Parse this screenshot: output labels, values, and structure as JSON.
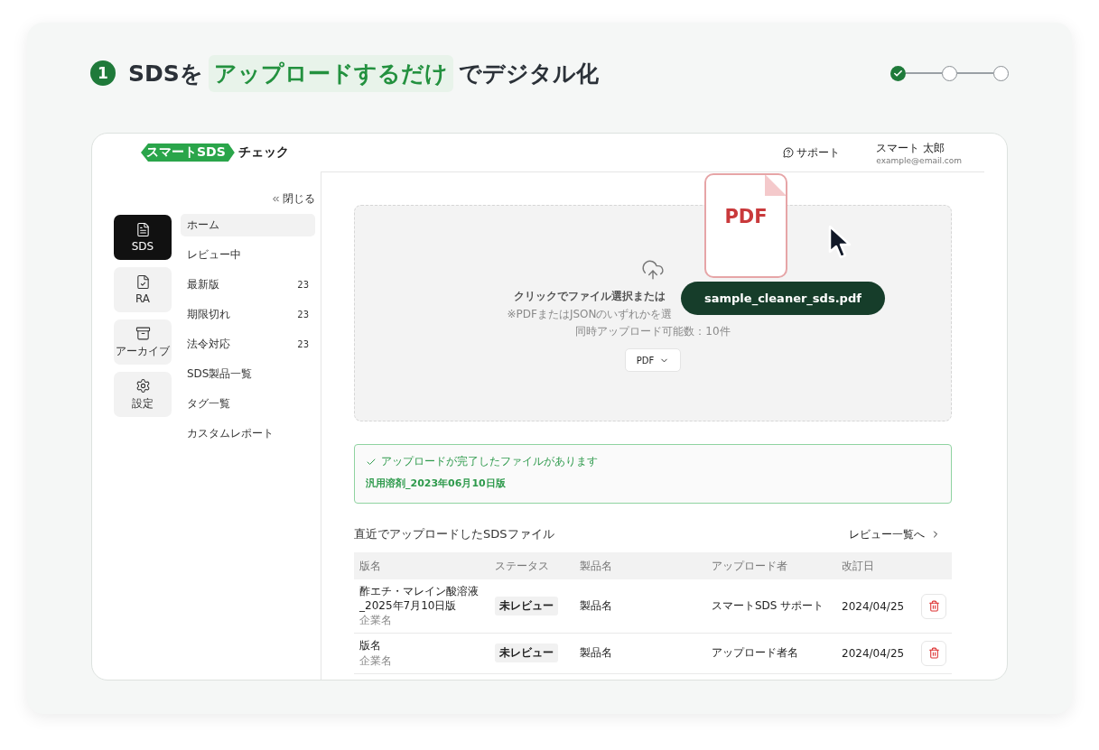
{
  "heading": {
    "number": "1",
    "parts": [
      {
        "text": "SDSを",
        "kind": "plain"
      },
      {
        "text": "アップロードするだけ",
        "kind": "highlight"
      },
      {
        "text": "でデジタル化",
        "kind": "plain"
      }
    ]
  },
  "steps": [
    {
      "done": true
    },
    {
      "done": false
    },
    {
      "done": false
    }
  ],
  "app": {
    "logo": {
      "badge": "スマートSDS",
      "word": "チェック"
    },
    "header": {
      "support": "サポート",
      "user_name": "スマート 太郎",
      "user_email": "example@email.com"
    },
    "rail": [
      {
        "label": "SDS",
        "selected": true
      },
      {
        "label": "RA",
        "selected": false
      },
      {
        "label": "アーカイブ",
        "selected": false
      },
      {
        "label": "設定",
        "selected": false
      }
    ],
    "collapse": "閉じる",
    "nav": [
      {
        "label": "ホーム",
        "selected": true
      },
      {
        "label": "レビュー中",
        "selected": false
      },
      {
        "label": "最新版",
        "count": "23",
        "selected": false
      },
      {
        "label": "期限切れ",
        "count": "23",
        "selected": false
      },
      {
        "label": "法令対応",
        "count": "23",
        "selected": false
      },
      {
        "label": "SDS製品一覧",
        "selected": false
      },
      {
        "label": "タグ一覧",
        "selected": false
      },
      {
        "label": "カスタムレポート",
        "selected": false
      }
    ],
    "dropzone": {
      "title": "クリックでファイル選択または",
      "note": "※PDFまたはJSONのいずれかを選",
      "limit": "同時アップロード可能数：10件",
      "format": "PDF"
    },
    "dragged_file": {
      "type": "PDF",
      "name": "sample_cleaner_sds.pdf"
    },
    "success": {
      "message": "アップロードが完了したファイルがあります",
      "file": "汎用溶剤_2023年06月10日版"
    },
    "recent": {
      "title": "直近でアップロードしたSDSファイル",
      "link": "レビュー一覧へ",
      "columns": [
        "版名",
        "ステータス",
        "製品名",
        "アップロード者",
        "改訂日"
      ],
      "rows": [
        {
          "edition": "酢エチ・マレイン酸溶液_2025年7月10日版",
          "company": "企業名",
          "status": "未レビュー",
          "product": "製品名",
          "uploader": "スマートSDS サポート",
          "date": "2024/04/25"
        },
        {
          "edition": "版名",
          "company": "企業名",
          "status": "未レビュー",
          "product": "製品名",
          "uploader": "アップロード者名",
          "date": "2024/04/25"
        }
      ]
    }
  }
}
